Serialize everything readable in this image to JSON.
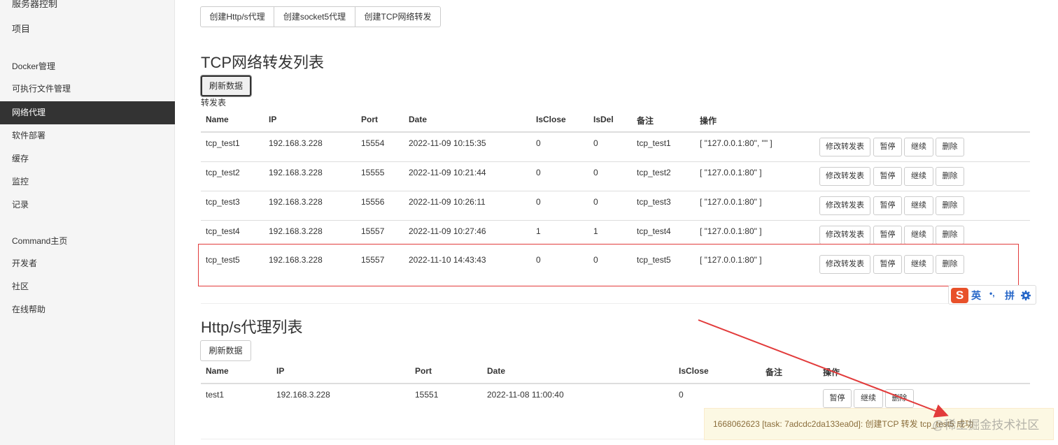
{
  "sidebar": {
    "items": [
      {
        "label": "服务器控制"
      },
      {
        "label": "项目"
      },
      {
        "label": "Docker管理"
      },
      {
        "label": "可执行文件管理"
      },
      {
        "label": "网络代理"
      },
      {
        "label": "软件部署"
      },
      {
        "label": "缓存"
      },
      {
        "label": "监控"
      },
      {
        "label": "记录"
      },
      {
        "label": "Command主页"
      },
      {
        "label": "开发者"
      },
      {
        "label": "社区"
      },
      {
        "label": "在线帮助"
      }
    ]
  },
  "create_group": {
    "http": "创建Http/s代理",
    "socket5": "创建socket5代理",
    "tcp": "创建TCP网络转发"
  },
  "tcp_section": {
    "title": "TCP网络转发列表",
    "refresh_label": "刷新数据",
    "caption": "转发表",
    "headers": [
      "Name",
      "IP",
      "Port",
      "Date",
      "IsClose",
      "IsDel",
      "备注",
      "操作"
    ],
    "rows": [
      {
        "name": "tcp_test1",
        "ip": "192.168.3.228",
        "port": "15554",
        "date": "2022-11-09 10:15:35",
        "isclose": "0",
        "isdel": "0",
        "note": "tcp_test1",
        "ops": "[ \"127.0.0.1:80\", \"\" ]"
      },
      {
        "name": "tcp_test2",
        "ip": "192.168.3.228",
        "port": "15555",
        "date": "2022-11-09 10:21:44",
        "isclose": "0",
        "isdel": "0",
        "note": "tcp_test2",
        "ops": "[ \"127.0.0.1:80\" ]"
      },
      {
        "name": "tcp_test3",
        "ip": "192.168.3.228",
        "port": "15556",
        "date": "2022-11-09 10:26:11",
        "isclose": "0",
        "isdel": "0",
        "note": "tcp_test3",
        "ops": "[ \"127.0.0.1:80\" ]"
      },
      {
        "name": "tcp_test4",
        "ip": "192.168.3.228",
        "port": "15557",
        "date": "2022-11-09 10:27:46",
        "isclose": "1",
        "isdel": "1",
        "note": "tcp_test4",
        "ops": "[ \"127.0.0.1:80\" ]"
      },
      {
        "name": "tcp_test5",
        "ip": "192.168.3.228",
        "port": "15557",
        "date": "2022-11-10 14:43:43",
        "isclose": "0",
        "isdel": "0",
        "note": "tcp_test5",
        "ops": "[ \"127.0.0.1:80\" ]"
      }
    ],
    "row_actions": {
      "modify": "修改转发表",
      "pause": "暂停",
      "resume": "继续",
      "delete": "删除"
    }
  },
  "http_section": {
    "title": "Http/s代理列表",
    "refresh_label": "刷新数据",
    "headers": [
      "Name",
      "IP",
      "Port",
      "Date",
      "IsClose",
      "备注",
      "操作"
    ],
    "rows": [
      {
        "name": "test1",
        "ip": "192.168.3.228",
        "port": "15551",
        "date": "2022-11-08 11:00:40",
        "isclose": "0",
        "note": ""
      }
    ],
    "row_actions": {
      "pause": "暂停",
      "resume": "继续",
      "delete": "删除"
    }
  },
  "ime": {
    "logo": "S",
    "lang": "英",
    "punct": "•,",
    "mode": "拼",
    "settings_icon": "gear-icon"
  },
  "toast": {
    "message": "1668062623 [task: 7adcdc2da133ea0d]: 创建TCP 转发 tcp_test5 成功"
  },
  "watermark": "@稀土掘金技术社区",
  "colors": {
    "sidebar_active": "#333333",
    "highlight": "#e23b3b",
    "arrow": "#e23b3b",
    "toast_bg": "#fcf8e3",
    "ime_brand": "#e8512a"
  }
}
